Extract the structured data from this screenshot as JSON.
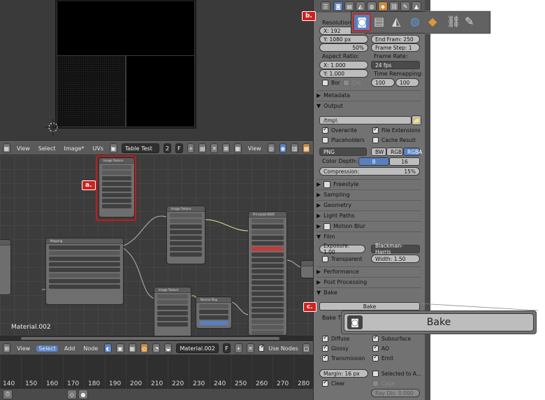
{
  "viewport": {
    "name": "3d-viewport"
  },
  "image_editor_header": {
    "menus": [
      "View",
      "Select",
      "Image*",
      "UVs"
    ],
    "image_name": "Table Test",
    "users": "2",
    "fake": "F",
    "view_label": "View"
  },
  "node_editor": {
    "material_label": "Material.002",
    "nodes": {
      "image_texture_1": {
        "title": "Image Texture",
        "outputs": [
          "Color",
          "Alpha"
        ],
        "options": [
          "Color",
          "Linear",
          "Flat",
          "Repeat",
          "Generated"
        ],
        "vector": "Vector"
      },
      "image_texture_2": {
        "title": "Image Texture",
        "outputs": [
          "Color",
          "Alpha"
        ],
        "options": [
          "Color",
          "Linear",
          "Flat",
          "Repeat",
          "Single Image"
        ],
        "vector": "Vector"
      },
      "image_texture_3": {
        "title": "Image Texture",
        "outputs": [
          "Color",
          "Alpha"
        ],
        "options": [
          "Non-Color Data",
          "Linear",
          "Flat",
          "Repeat"
        ]
      },
      "mapping": {
        "title": "Mapping",
        "modes": [
          "Texture",
          "Point",
          "Vector",
          "Normal"
        ],
        "headers": [
          "Location:",
          "Rotation:",
          "Scale:"
        ],
        "rows": [
          [
            "X: 0.000",
            "X: 0°",
            "X: 2.000"
          ],
          [
            "Y: 0.000",
            "Y: 0°",
            "Y: 2.000"
          ],
          [
            "Z: 0.000",
            "Z: 0°",
            "Z: 2.000"
          ]
        ],
        "min_label": "Min",
        "max_label": "Max",
        "vector": "Vector"
      },
      "normal_map": {
        "title": "Normal Map",
        "output": "Normal",
        "space": "Tangent Space",
        "strength": "Strength: 1.000",
        "color": "Color"
      },
      "principled": {
        "title": "Principled BSDF",
        "output": "BSDF",
        "distribution": "Multiscatter GGX",
        "inputs": [
          "Base Color",
          "Subsurface: 0.000",
          "Subsurface Radius",
          "Subsurface Color",
          "Metallic: 0.000",
          "Specular: 0.500",
          "Specular Tint: 0.000",
          "Roughness: 0.500",
          "Anisotropic: 0.000",
          "Anisotropic: 0.000",
          "Sheen: 0.000",
          "Sheen Tint: 0.500",
          "Clearcoat: 0.000",
          "Clearcoat Rou: 0.030",
          "IOR: 1.450",
          "Transmissio: 0.000",
          "Normal",
          "Clearcoat Normal",
          "Tangent"
        ]
      }
    }
  },
  "node_header": {
    "menus": [
      "View",
      "Select",
      "Add",
      "Node"
    ],
    "active_menu": "Select",
    "material": "Material.002",
    "fake": "F",
    "use_nodes": "Use Nodes"
  },
  "timeline": {
    "ticks": [
      "140",
      "150",
      "160",
      "170",
      "180",
      "190",
      "200",
      "210",
      "220",
      "230",
      "240",
      "250",
      "260",
      "270",
      "280"
    ]
  },
  "properties": {
    "resolution_label": "Resolution:",
    "res_x": "X:   192",
    "res_y": "Y:  1080 px",
    "res_percent": "50%",
    "end_frame": "End Fram: 250",
    "frame_step": "Frame Step:  1",
    "aspect_label": "Aspect Ratio:",
    "aspect_x": "X:     1.000",
    "aspect_y": "Y:     1.000",
    "frame_rate_label": "Frame Rate:",
    "frame_rate": "24 fps",
    "time_remap_label": "Time Remapping:",
    "remap_old": "100",
    "remap_new": "100",
    "border_label": "Bor",
    "crop_label": "Cro",
    "sections": {
      "metadata": "Metadata",
      "output": "Output",
      "freestyle": "Freestyle",
      "sampling": "Sampling",
      "geometry": "Geometry",
      "light_paths": "Light Paths",
      "motion_blur": "Motion Blur",
      "film": "Film",
      "performance": "Performance",
      "post_processing": "Post Processing",
      "bake": "Bake"
    },
    "output_path": "/tmp\\",
    "overwrite": "Overwrite",
    "file_extensions": "File Extensions",
    "placeholders": "Placeholders",
    "cache_result": "Cache Result",
    "format": "PNG",
    "color_modes": [
      "BW",
      "RGB",
      "RGBA"
    ],
    "color_depth_label": "Color Depth:",
    "depth_8": "8",
    "depth_16": "16",
    "compression": "Compression:",
    "compression_value": "15%",
    "exposure": "Exposure: 1.00",
    "filter": "Blackman-Harris",
    "transparent": "Transparent",
    "width": "Width:    1.50",
    "bake_button": "Bake",
    "bake_type": "Bake T",
    "diffuse": "Diffuse",
    "subsurface": "Subsurface",
    "glossy": "Glossy",
    "ao": "AO",
    "transmission": "Transmission",
    "emit": "Emit",
    "margin": "Margin:  16 px",
    "selected_to_active": "Selected to A...",
    "clear": "Clear",
    "cage": "Cage",
    "ray_distance": "Ray Dis: 0.000"
  },
  "callouts": {
    "a": "a.",
    "b": "b.",
    "c": "c.",
    "zoom_bake_label": "Bake"
  }
}
